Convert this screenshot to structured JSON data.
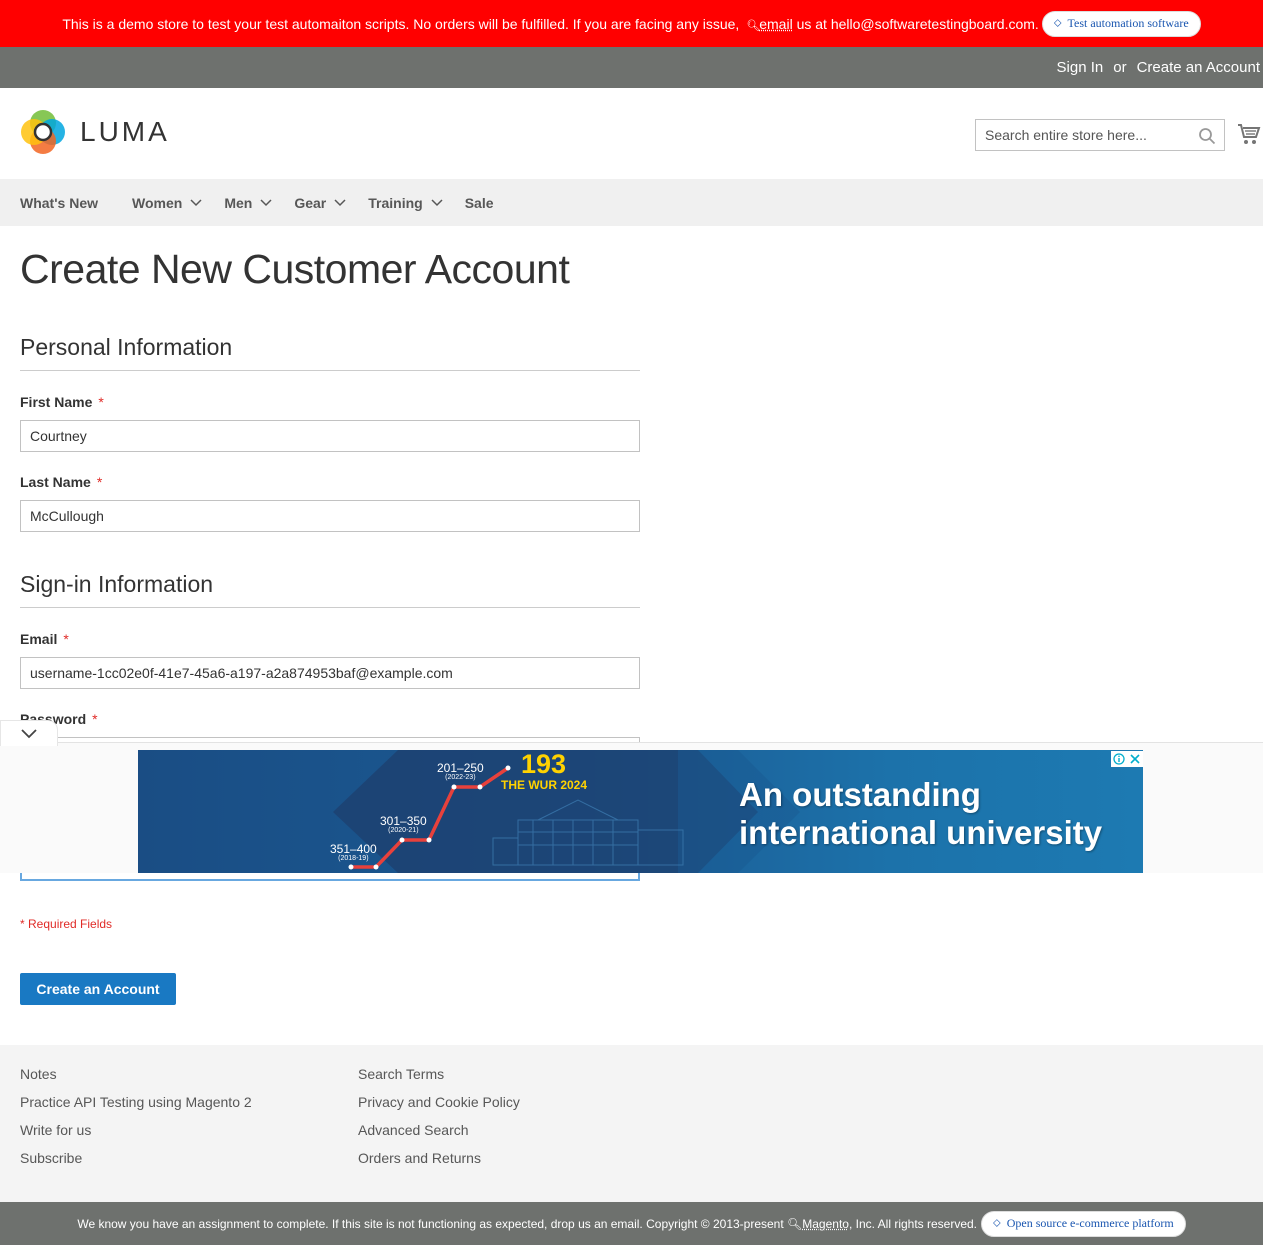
{
  "demo_banner": {
    "text_before": "This is a demo store to test your test automaiton scripts. No orders will be fulfilled. If you are facing any issue,",
    "link": "email",
    "text_after": "us at hello@softwaretestingboard.com.",
    "pill": "Test automation software"
  },
  "top_links": {
    "sign_in": "Sign In",
    "or": "or",
    "create_account": "Create an Account"
  },
  "logo": {
    "text": "LUMA"
  },
  "search": {
    "placeholder": "Search entire store here..."
  },
  "nav": {
    "items": [
      {
        "label": "What's New",
        "dropdown": false
      },
      {
        "label": "Women",
        "dropdown": true
      },
      {
        "label": "Men",
        "dropdown": true
      },
      {
        "label": "Gear",
        "dropdown": true
      },
      {
        "label": "Training",
        "dropdown": true
      },
      {
        "label": "Sale",
        "dropdown": false
      }
    ]
  },
  "page": {
    "title": "Create New Customer Account",
    "personal_legend": "Personal Information",
    "first_name_label": "First Name",
    "first_name_value": "Courtney",
    "last_name_label": "Last Name",
    "last_name_value": "McCullough",
    "signin_legend": "Sign-in Information",
    "email_label": "Email",
    "email_value": "username-1cc02e0f-41e7-45a6-a197-a2a874953baf@example.com",
    "password_label": "Password",
    "required_star": "*",
    "required_note": "* Required Fields",
    "create_button": "Create an Account"
  },
  "ad": {
    "headline_line1": "An outstanding",
    "headline_line2": "international university",
    "rank": "193",
    "rank_label": "THE WUR 2024",
    "points": [
      {
        "range": "351–400",
        "year": "(2018-19)"
      },
      {
        "range": "301–350",
        "year": "(2020-21)"
      },
      {
        "range": "201–250",
        "year": "(2022-23)"
      }
    ]
  },
  "footer": {
    "col1": [
      "Notes",
      "Practice API Testing using Magento 2",
      "Write for us",
      "Subscribe"
    ],
    "col2": [
      "Search Terms",
      "Privacy and Cookie Policy",
      "Advanced Search",
      "Orders and Returns"
    ]
  },
  "copyright": {
    "text_before": "We know you have an assignment to complete. If this site is not functioning as expected, drop us an email. Copyright © 2013-present",
    "link": "Magento",
    "text_after": ", Inc. All rights reserved.",
    "pill": "Open source e-commerce platform"
  }
}
